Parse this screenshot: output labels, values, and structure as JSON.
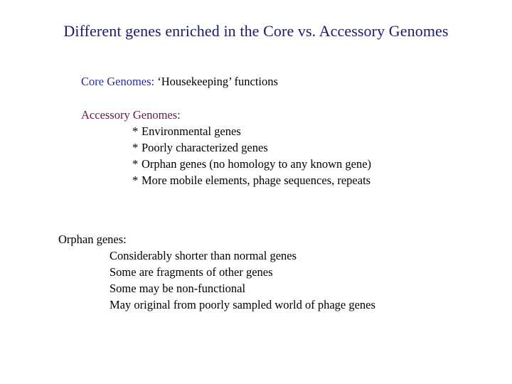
{
  "slide": {
    "title": "Different genes enriched in the Core vs. Accessory Genomes",
    "core": {
      "label": "Core Genomes",
      "separator": ":",
      "text": "  ‘Housekeeping’ functions"
    },
    "accessory": {
      "label": "Accessory Genomes:",
      "bullet_glyph": "*",
      "items": [
        "Environmental genes",
        "Poorly characterized genes",
        "Orphan genes (no homology to any known gene)",
        "More mobile elements, phage sequences, repeats"
      ]
    },
    "orphan": {
      "label": "Orphan genes:",
      "items": [
        "Considerably shorter than normal genes",
        "Some are fragments of other genes",
        "Some may be non-functional",
        "May original from poorly sampled world of phage genes"
      ]
    },
    "colors": {
      "title": "#191970",
      "core_label": "#2a2a9e",
      "accessory_label": "#5e1a4e",
      "body_text": "#000000",
      "background": "#ffffff"
    }
  }
}
